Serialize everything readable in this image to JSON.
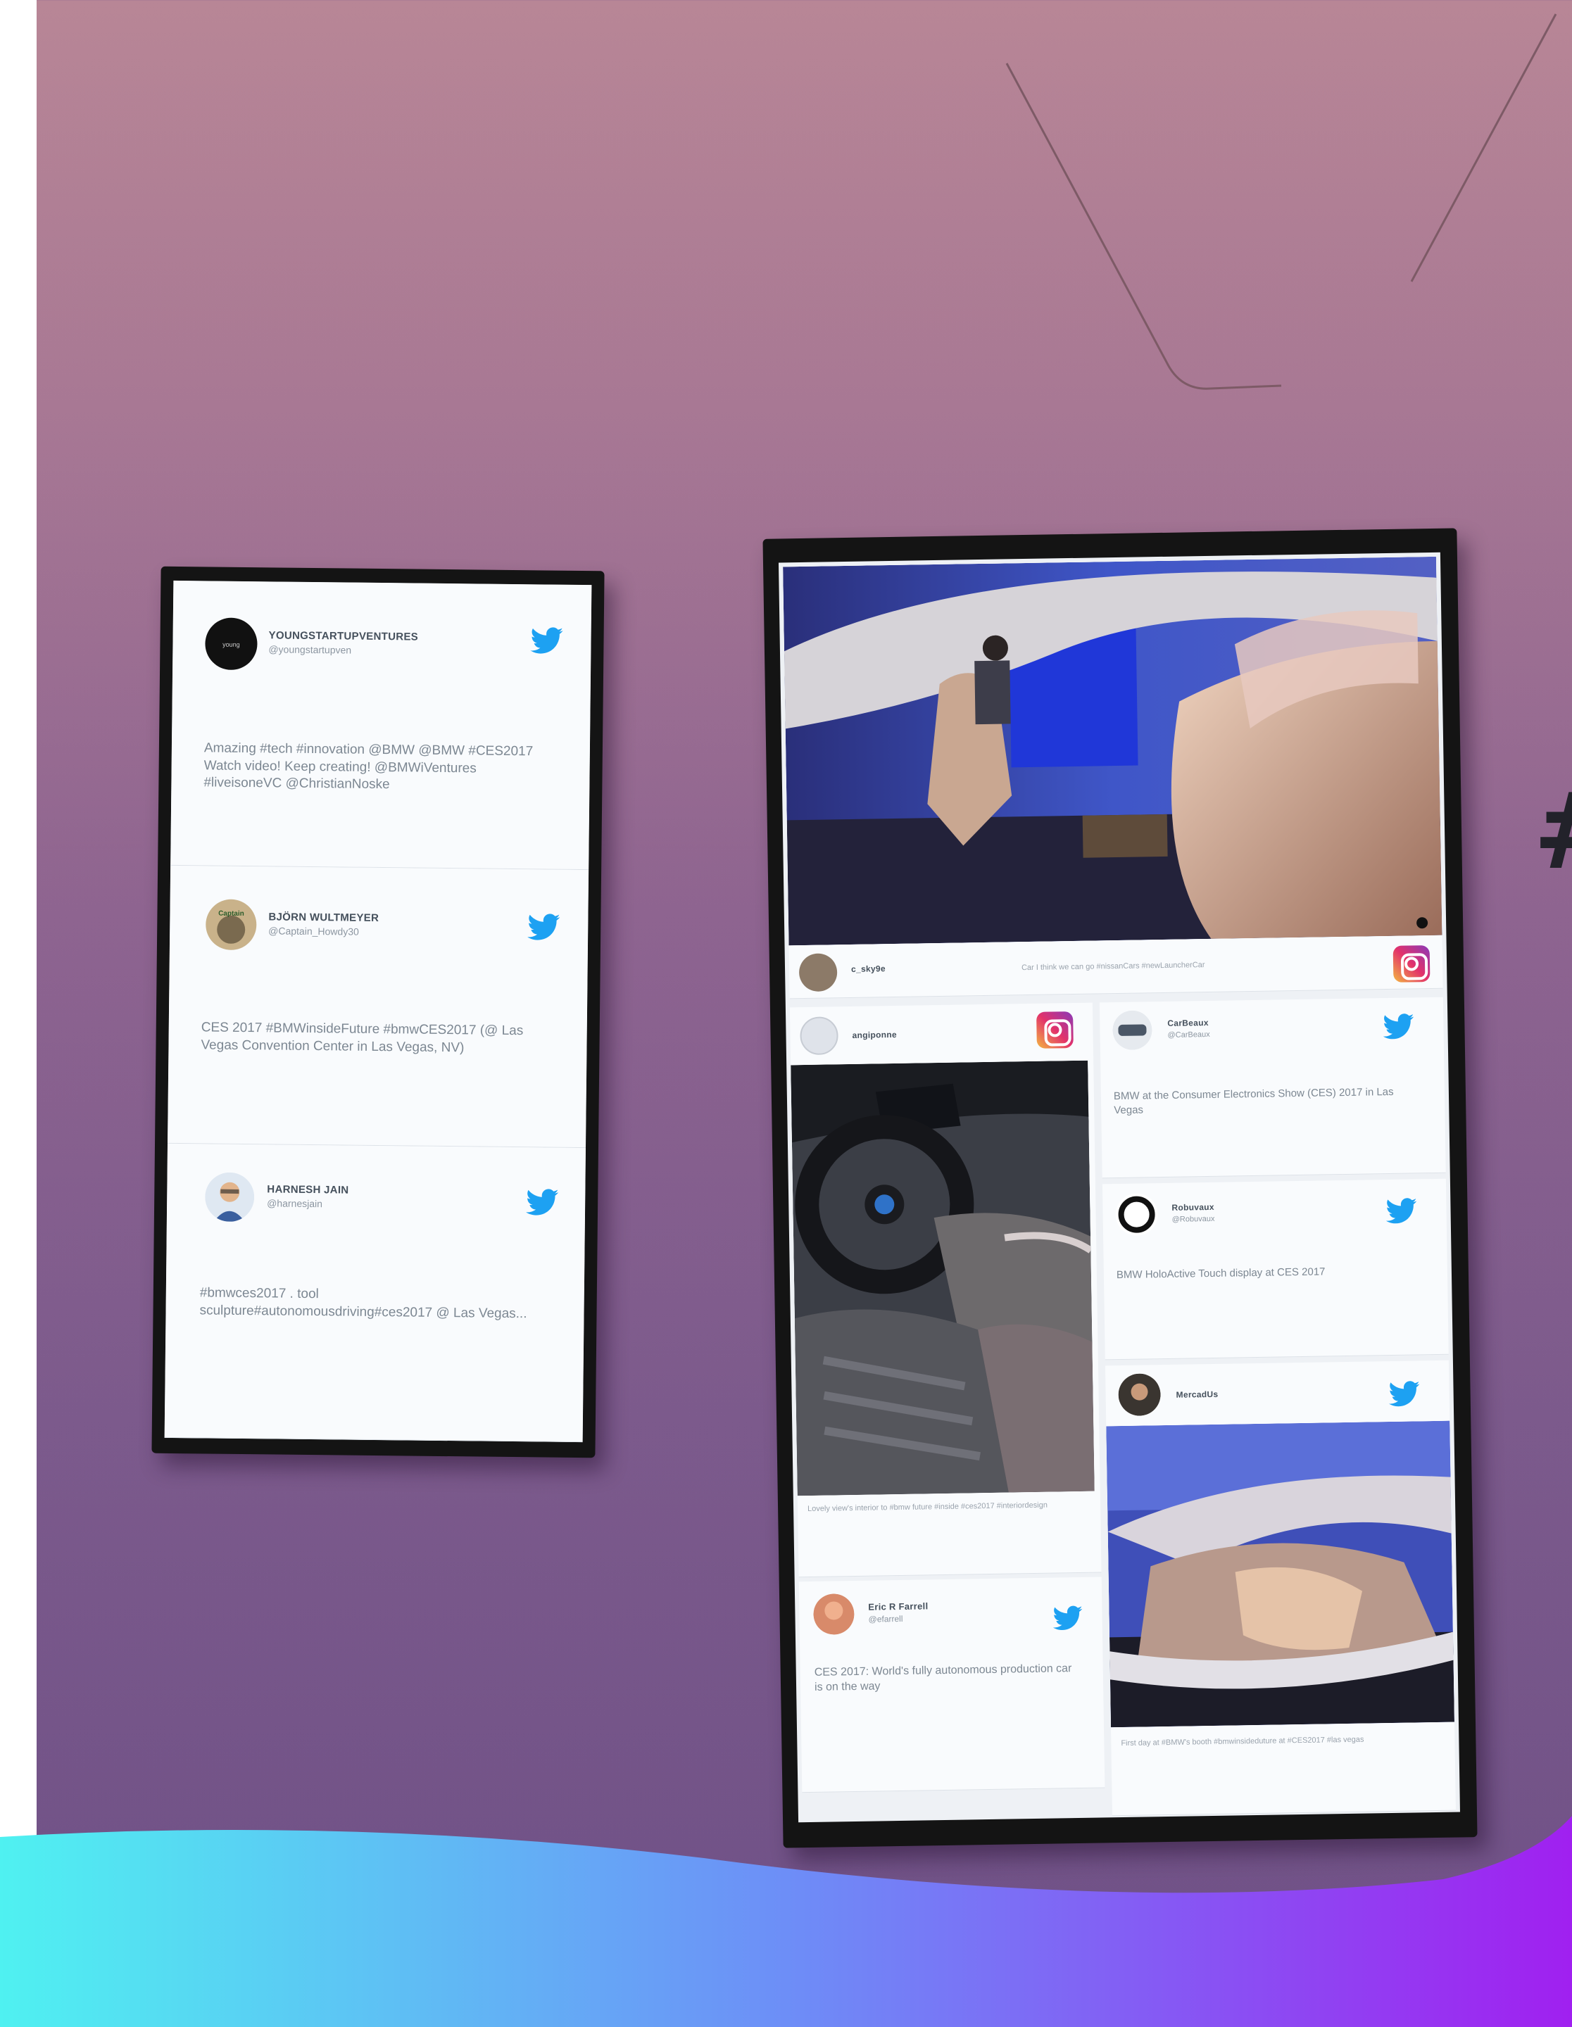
{
  "left_screen": {
    "tweets": [
      {
        "name": "YOUNGSTARTUPVENTURES",
        "handle": "@youngstartupven",
        "text": "Amazing #tech #innovation @BMW @BMW #CES2017 Watch video! Keep creating! @BMWiVentures #liveisoneVC @ChristianNoske",
        "icon": "twitter-bird"
      },
      {
        "name": "BJÖRN WULTMEYER",
        "handle": "@Captain_Howdy30",
        "text": "CES 2017 #BMWinsideFuture #bmwCES2017 (@ Las Vegas Convention Center in Las Vegas, NV)",
        "icon": "twitter-bird"
      },
      {
        "name": "HARNESH JAIN",
        "handle": "@harnesjain",
        "text": "#bmwces2017 . tool sculpture#autonomousdriving#ces2017 @ Las Vegas...",
        "icon": "twitter-bird"
      }
    ]
  },
  "right_screen": {
    "top_post": {
      "name": "c_sky9e",
      "caption": "Car I think we can go #nissanCars #newLauncherCar",
      "icon": "instagram"
    },
    "left_column": {
      "insta_name": "angiponne",
      "insta_caption": "Lovely view's interior to #bmw future #inside #ces2017 #interiordesign",
      "tweet": {
        "name": "Eric R Farrell",
        "handle": "@efarrell",
        "text": "CES 2017: World's fully autonomous production car is on the way"
      }
    },
    "right_column": [
      {
        "name": "CarBeaux",
        "handle": "@CarBeaux",
        "text": "BMW at the Consumer Electronics Show (CES) 2017 in Las Vegas"
      },
      {
        "name": "Robuvaux",
        "handle": "@Robuvaux",
        "text": "BMW HoloActive Touch display at CES 2017"
      },
      {
        "name": "MercadUs",
        "caption": "First day at #BMW's booth #bmwinsideduture at #CES2017 #las vegas"
      }
    ]
  },
  "colors": {
    "twitter_blue": "#1da1f2",
    "screen_bg": "#eef1f5",
    "wall_top": "#b88696",
    "wall_bottom": "#6e5086",
    "wave_left": "#4ff1f1",
    "wave_right": "#a020f0"
  },
  "overlay": {
    "edge_char": "#"
  }
}
